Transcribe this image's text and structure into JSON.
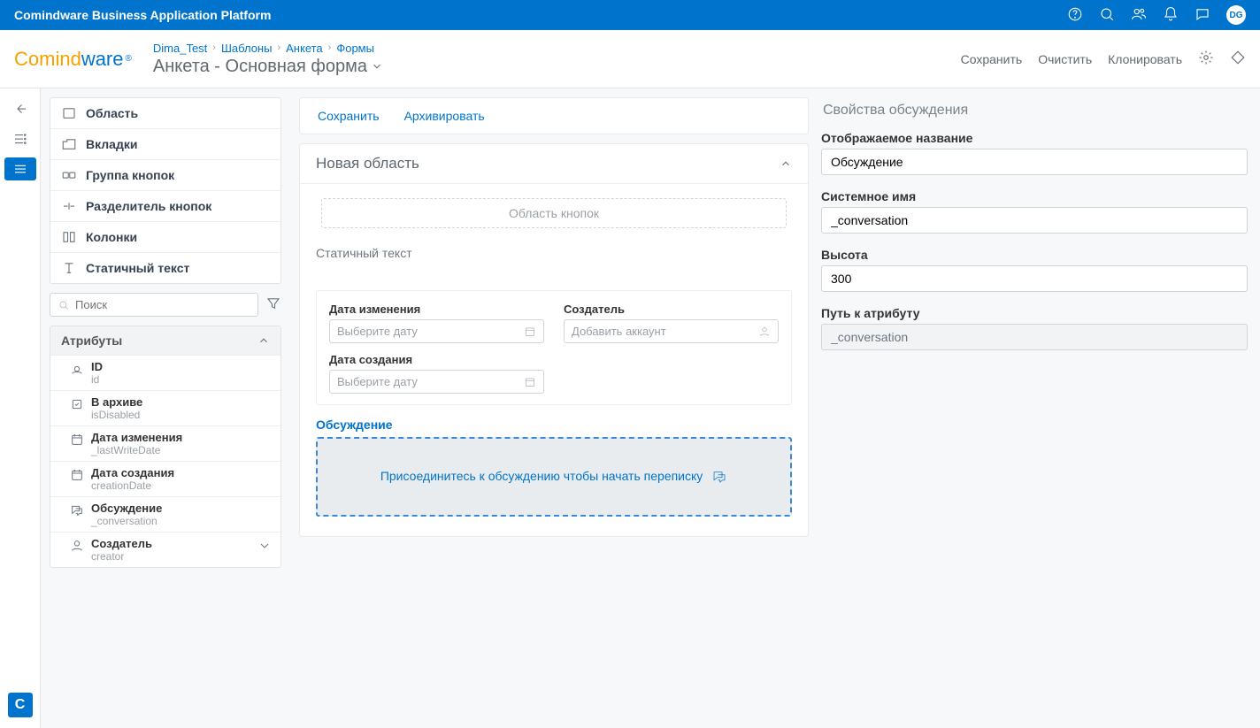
{
  "app": {
    "name": "Comindware Business Application Platform",
    "avatar": "DG"
  },
  "logo": {
    "part1": "Comind",
    "part2": "ware"
  },
  "breadcrumbs": [
    "Dima_Test",
    "Шаблоны",
    "Анкета",
    "Формы"
  ],
  "pageTitle": "Анкета - Основная форма",
  "headerActions": {
    "save": "Сохранить",
    "clear": "Очистить",
    "clone": "Клонировать"
  },
  "rail": {
    "bottom": "C"
  },
  "palette": {
    "items": [
      {
        "label": "Область"
      },
      {
        "label": "Вкладки"
      },
      {
        "label": "Группа кнопок"
      },
      {
        "label": "Разделитель кнопок"
      },
      {
        "label": "Колонки"
      },
      {
        "label": "Статичный текст"
      }
    ],
    "searchPlaceholder": "Поиск",
    "attrsHead": "Атрибуты",
    "attrs": [
      {
        "name": "ID",
        "sys": "id"
      },
      {
        "name": "В архиве",
        "sys": "isDisabled"
      },
      {
        "name": "Дата изменения",
        "sys": "_lastWriteDate"
      },
      {
        "name": "Дата создания",
        "sys": "creationDate"
      },
      {
        "name": "Обсуждение",
        "sys": "_conversation"
      },
      {
        "name": "Создатель",
        "sys": "creator"
      }
    ]
  },
  "toolbar": {
    "save": "Сохранить",
    "archive": "Архивировать"
  },
  "region": {
    "title": "Новая область",
    "btnArea": "Область кнопок",
    "staticText": "Статичный текст",
    "fields": {
      "f1_label": "Дата изменения",
      "f1_ph": "Выберите дату",
      "f2_label": "Создатель",
      "f2_ph": "Добавить аккаунт",
      "f3_label": "Дата создания",
      "f3_ph": "Выберите дату"
    },
    "discussLabel": "Обсуждение",
    "discussText": "Присоединитесь к обсуждению чтобы начать переписку"
  },
  "props": {
    "title": "Свойства обсуждения",
    "l1": "Отображаемое название",
    "v1": "Обсуждение",
    "l2": "Системное имя",
    "v2": "_conversation",
    "l3": "Высота",
    "v3": "300",
    "l4": "Путь к атрибуту",
    "v4": "_conversation"
  }
}
